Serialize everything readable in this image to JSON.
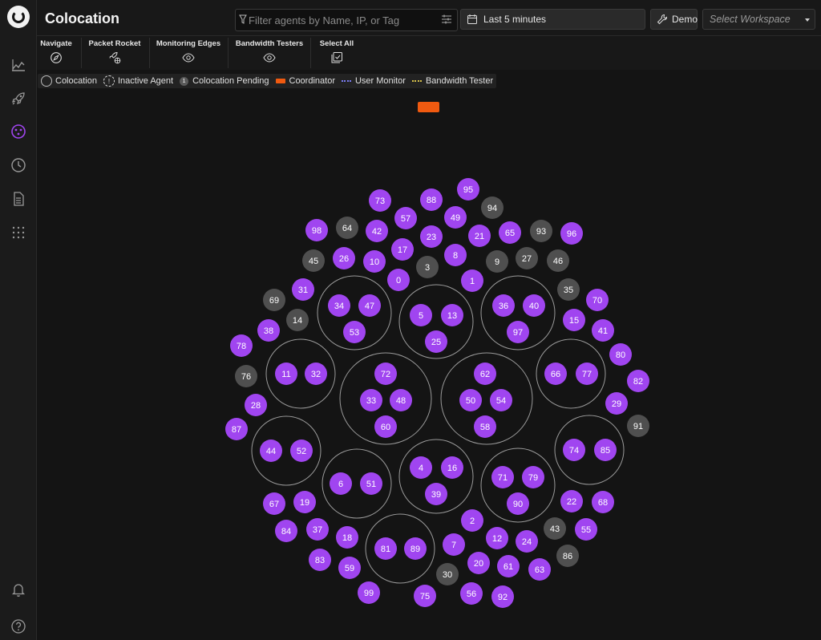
{
  "app": {
    "title": "Colocation"
  },
  "header": {
    "filter_placeholder": "Filter agents by Name, IP, or Tag",
    "time_range": "Last 5 minutes",
    "demo_label": "Demo",
    "workspace_placeholder": "Select Workspace"
  },
  "toolbar": {
    "items": [
      {
        "label": "Navigate",
        "icon": "compass-icon"
      },
      {
        "label": "Packet Rocket",
        "icon": "rocket-globe-icon"
      },
      {
        "label": "Monitoring Edges",
        "icon": "eye-icon"
      },
      {
        "label": "Bandwidth Testers",
        "icon": "eye-icon"
      },
      {
        "label": "Select All",
        "icon": "select-all-icon"
      }
    ]
  },
  "legend": {
    "colocation": "Colocation",
    "inactive_agent": "Inactive Agent",
    "pending_badge": "1",
    "colocation_pending": "Colocation Pending",
    "coordinator": "Coordinator",
    "user_monitor": "User Monitor",
    "bandwidth_tester": "Bandwidth Tester"
  },
  "sidebar": {
    "icons": [
      "chart-icon",
      "rocket-icon",
      "colocation-icon",
      "clock-icon",
      "document-icon",
      "grid-icon",
      "bell-icon",
      "help-icon"
    ]
  },
  "colors": {
    "accent": "#a045f0",
    "inactive": "#4f4f4f",
    "coordinator": "#f05a10",
    "user_monitor": "#7a7cf2",
    "bandwidth_tester": "#d8c24a"
  },
  "graph": {
    "active_agents": [
      "0",
      "1",
      "2",
      "4",
      "5",
      "6",
      "7",
      "8",
      "10",
      "11",
      "12",
      "13",
      "15",
      "16",
      "17",
      "18",
      "19",
      "20",
      "21",
      "22",
      "23",
      "24",
      "25",
      "26",
      "28",
      "29",
      "31",
      "32",
      "33",
      "34",
      "36",
      "37",
      "38",
      "39",
      "40",
      "41",
      "42",
      "44",
      "47",
      "48",
      "49",
      "50",
      "51",
      "52",
      "53",
      "54",
      "55",
      "56",
      "57",
      "58",
      "59",
      "60",
      "61",
      "62",
      "63",
      "65",
      "66",
      "67",
      "68",
      "70",
      "71",
      "72",
      "73",
      "74",
      "75",
      "77",
      "78",
      "79",
      "80",
      "81",
      "82",
      "83",
      "84",
      "85",
      "87",
      "88",
      "89",
      "90",
      "92",
      "95",
      "96",
      "97",
      "98",
      "99"
    ],
    "inactive_agents": [
      "3",
      "9",
      "14",
      "27",
      "30",
      "35",
      "43",
      "45",
      "46",
      "64",
      "69",
      "76",
      "86",
      "91",
      "93",
      "94"
    ]
  }
}
